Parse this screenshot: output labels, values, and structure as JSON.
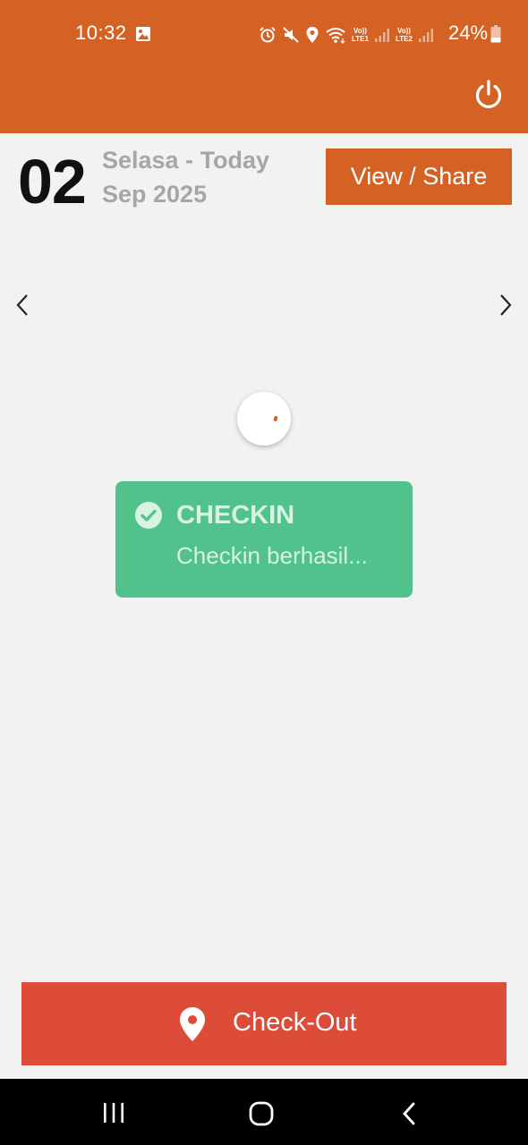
{
  "status_bar": {
    "time": "10:32",
    "battery": "24%",
    "lte1_top": "Vo))",
    "lte1_bottom": "LTE1",
    "lte2_top": "Vo))",
    "lte2_bottom": "LTE2",
    "icons": [
      "gallery-icon",
      "alarm-icon",
      "mute-icon",
      "location-icon",
      "wifi-icon",
      "signal-icon",
      "battery-icon"
    ]
  },
  "header": {
    "power_icon": "power-icon",
    "accent_color": "#d46225"
  },
  "date": {
    "day": "02",
    "line1": "Selasa - Today",
    "line2": "Sep 2025"
  },
  "actions": {
    "view_share_label": "View / Share"
  },
  "navigation": {
    "prev_icon": "chevron-left-icon",
    "next_icon": "chevron-right-icon"
  },
  "toast": {
    "title": "CHECKIN",
    "message": "Checkin berhasil...",
    "color": "#52c28d"
  },
  "checkout": {
    "label": "Check-Out",
    "color": "#dd4b39",
    "icon": "location-pin-icon"
  },
  "system_nav": {
    "icons": [
      "recents-icon",
      "home-icon",
      "back-icon"
    ]
  }
}
